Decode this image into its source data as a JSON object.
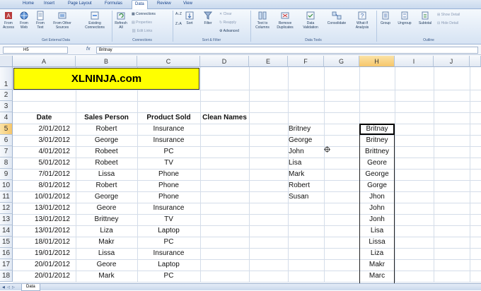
{
  "ribbon": {
    "tabs": [
      "Home",
      "Insert",
      "Page Layout",
      "Formulas",
      "Data",
      "Review",
      "View"
    ],
    "active_tab": "Data",
    "groups": {
      "get_external": {
        "label": "Get External Data",
        "buttons": [
          {
            "label": "From Access",
            "icon": "access-icon"
          },
          {
            "label": "From Web",
            "icon": "web-icon"
          },
          {
            "label": "From Text",
            "icon": "text-file-icon"
          },
          {
            "label": "From Other Sources",
            "icon": "other-sources-icon"
          },
          {
            "label": "Existing Connections",
            "icon": "existing-connections-icon"
          }
        ]
      },
      "connections": {
        "label": "Connections",
        "refresh": "Refresh All",
        "small": [
          "Connections",
          "Properties",
          "Edit Links"
        ]
      },
      "sort_filter": {
        "label": "Sort & Filter",
        "sort": "Sort",
        "filter": "Filter",
        "small": [
          "Clear",
          "Reapply",
          "Advanced"
        ]
      },
      "data_tools": {
        "label": "Data Tools",
        "buttons": [
          {
            "label": "Text to Columns",
            "icon": "text-to-columns-icon"
          },
          {
            "label": "Remove Duplicates",
            "icon": "remove-duplicates-icon"
          },
          {
            "label": "Data Validation",
            "icon": "data-validation-icon"
          },
          {
            "label": "Consolidate",
            "icon": "consolidate-icon"
          },
          {
            "label": "What-If Analysis",
            "icon": "what-if-icon"
          }
        ]
      },
      "outline": {
        "label": "Outline",
        "buttons": [
          {
            "label": "Group",
            "icon": "group-icon"
          },
          {
            "label": "Ungroup",
            "icon": "ungroup-icon"
          },
          {
            "label": "Subtotal",
            "icon": "subtotal-icon"
          }
        ],
        "small": [
          "Show Detail",
          "Hide Detail"
        ]
      }
    }
  },
  "formula_bar": {
    "name_box": "H5",
    "fx": "fx",
    "value": "Britnay"
  },
  "columns": [
    "A",
    "B",
    "C",
    "D",
    "E",
    "F",
    "G",
    "H",
    "I",
    "J"
  ],
  "rows": [
    "1",
    "2",
    "3",
    "4",
    "5",
    "6",
    "7",
    "8",
    "9",
    "10",
    "11",
    "12",
    "13",
    "14",
    "15",
    "16",
    "17",
    "18"
  ],
  "banner": "XLNINJA.com",
  "headers": {
    "date": "Date",
    "sales_person": "Sales Person",
    "product": "Product Sold",
    "clean": "Clean Names"
  },
  "table": [
    [
      "2/01/2012",
      "Robert",
      "Insurance"
    ],
    [
      "3/01/2012",
      "George",
      "Insurance"
    ],
    [
      "4/01/2012",
      "Robeet",
      "PC"
    ],
    [
      "5/01/2012",
      "Robeet",
      "TV"
    ],
    [
      "7/01/2012",
      "Lissa",
      "Phone"
    ],
    [
      "8/01/2012",
      "Robert",
      "Phone"
    ],
    [
      "10/01/2012",
      "George",
      "Phone"
    ],
    [
      "13/01/2012",
      "Geore",
      "Insurance"
    ],
    [
      "13/01/2012",
      "Brittney",
      "TV"
    ],
    [
      "13/01/2012",
      "Liza",
      "Laptop"
    ],
    [
      "18/01/2012",
      "Makr",
      "PC"
    ],
    [
      "19/01/2012",
      "Lissa",
      "Insurance"
    ],
    [
      "20/01/2012",
      "Geore",
      "Laptop"
    ],
    [
      "20/01/2012",
      "Mark",
      "PC"
    ]
  ],
  "clean_list": [
    "Britney",
    "George",
    "John",
    "Lisa",
    "Mark",
    "Robert",
    "Susan"
  ],
  "column_h": [
    "Britnay",
    "Britney",
    "Brittney",
    "Geore",
    "George",
    "Gorge",
    "Jhon",
    "John",
    "Jonh",
    "Lisa",
    "Lissa",
    "Liza",
    "Makr",
    "Marc"
  ],
  "sheet_tab": "Data"
}
